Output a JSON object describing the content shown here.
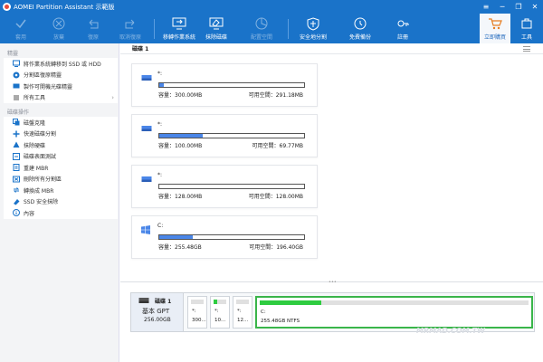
{
  "window": {
    "title": "AOMEI Partition Assistant 示範版",
    "controls": [
      "≡",
      "─",
      "❐",
      "✕"
    ]
  },
  "toolbar": {
    "buttons": [
      {
        "label": "套用",
        "icon": "check-icon",
        "enabled": false
      },
      {
        "label": "放棄",
        "icon": "discard-icon",
        "enabled": false
      },
      {
        "label": "復原",
        "icon": "undo-icon",
        "enabled": false
      },
      {
        "label": "取消復原",
        "icon": "redo-icon",
        "enabled": false
      },
      {
        "label": "移轉作業系統",
        "icon": "migrate-os-icon",
        "enabled": true
      },
      {
        "label": "抹除磁碟",
        "icon": "wipe-disk-icon",
        "enabled": true
      },
      {
        "label": "配置空間",
        "icon": "allocate-space-icon",
        "enabled": false
      },
      {
        "label": "安全地分割",
        "icon": "shield-icon",
        "enabled": true
      },
      {
        "label": "免費備份",
        "icon": "backup-icon",
        "enabled": true
      },
      {
        "label": "註冊",
        "icon": "key-icon",
        "enabled": true
      },
      {
        "label": "立即購買",
        "icon": "cart-icon",
        "enabled": true
      },
      {
        "label": "工具",
        "icon": "tools-icon",
        "enabled": true
      }
    ]
  },
  "sidebar": {
    "wizard_title": "精靈",
    "wizard_items": [
      {
        "label": "將作業系統轉移到 SSD 或 HDD",
        "icon": "migrate-icon"
      },
      {
        "label": "分割區復原精靈",
        "icon": "recovery-icon"
      },
      {
        "label": "製作可開機光碟精靈",
        "icon": "bootable-disc-icon"
      },
      {
        "label": "所有工具",
        "icon": "all-tools-icon",
        "chevron": "›"
      }
    ],
    "disk_ops_title": "磁碟操作",
    "disk_items": [
      {
        "label": "磁盤克隆",
        "icon": "clone-icon"
      },
      {
        "label": "快速磁碟分割",
        "icon": "quick-partition-icon"
      },
      {
        "label": "抹除硬碟",
        "icon": "wipe-icon"
      },
      {
        "label": "磁碟表面測試",
        "icon": "surface-test-icon"
      },
      {
        "label": "重建 MBR",
        "icon": "rebuild-mbr-icon"
      },
      {
        "label": "刪除所有分割區",
        "icon": "delete-partitions-icon"
      },
      {
        "label": "轉換成 MBR",
        "icon": "convert-mbr-icon"
      },
      {
        "label": "SSD 安全抹除",
        "icon": "ssd-erase-icon"
      },
      {
        "label": "內容",
        "icon": "info-icon"
      }
    ]
  },
  "main": {
    "header": "磁碟 1",
    "partitions": [
      {
        "letter": "*:",
        "icon": "disk-icon",
        "capacity": "容量：300.00MB",
        "free": "可用空間：291.18MB",
        "used_fraction": 0.03
      },
      {
        "letter": "*:",
        "icon": "disk-icon",
        "capacity": "容量：100.00MB",
        "free": "可用空間：69.77MB",
        "used_fraction": 0.3
      },
      {
        "letter": "*:",
        "icon": "disk-icon",
        "capacity": "容量：128.00MB",
        "free": "可用空間：128.00MB",
        "used_fraction": 0.0
      },
      {
        "letter": "C:",
        "icon": "windows-icon",
        "capacity": "容量：255.48GB",
        "free": "可用空間：196.40GB",
        "used_fraction": 0.23
      }
    ]
  },
  "disk_map": {
    "name": "磁碟 1",
    "type": "基本 GPT",
    "size": "256.00GB",
    "parts": [
      {
        "label": "*:",
        "size": "300...",
        "used_fraction": 0.0
      },
      {
        "label": "*:",
        "size": "10...",
        "used_fraction": 0.3
      },
      {
        "label": "*:",
        "size": "12...",
        "used_fraction": 0.0
      },
      {
        "label": "C:",
        "size": "255.48GB NTFS",
        "used_fraction": 0.23
      }
    ]
  },
  "watermark": "MRMAD.COM.TW",
  "colors": {
    "toolbar": "#1a73c9",
    "usage_bar": "#4a86e8",
    "disk_map_bar": "#2ecc40"
  }
}
